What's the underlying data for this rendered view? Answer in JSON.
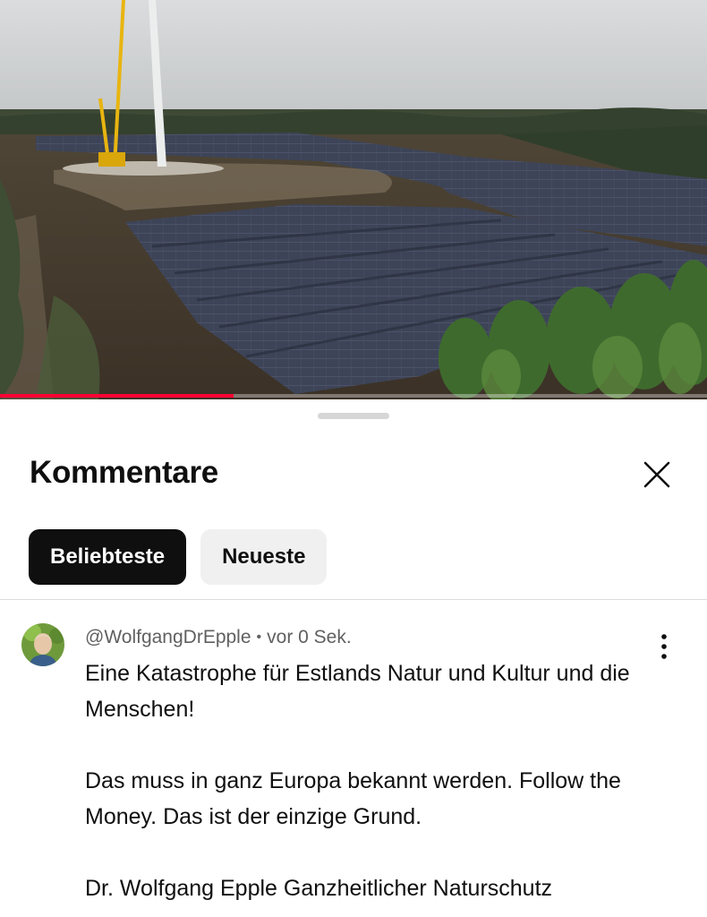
{
  "video": {
    "progress_fraction": 0.33,
    "accent_color": "#ff0033"
  },
  "sheet": {
    "title": "Kommentare",
    "close_icon": "close-icon"
  },
  "filters": {
    "items": [
      {
        "label": "Beliebteste",
        "selected": true
      },
      {
        "label": "Neueste",
        "selected": false
      }
    ]
  },
  "comment": {
    "author": "@WolfgangDrEpple",
    "separator": "•",
    "time": "vor 0 Sek.",
    "paragraph_1": "Eine Katastrophe für Estlands Natur und Kultur und die Menschen!",
    "paragraph_2": "Das muss in ganz Europa bekannt werden. Follow the Money. Das ist der einzige Grund.",
    "paragraph_3": "Dr. Wolfgang Epple Ganzheitlicher Naturschutz",
    "more_icon": "more-vertical-icon"
  }
}
